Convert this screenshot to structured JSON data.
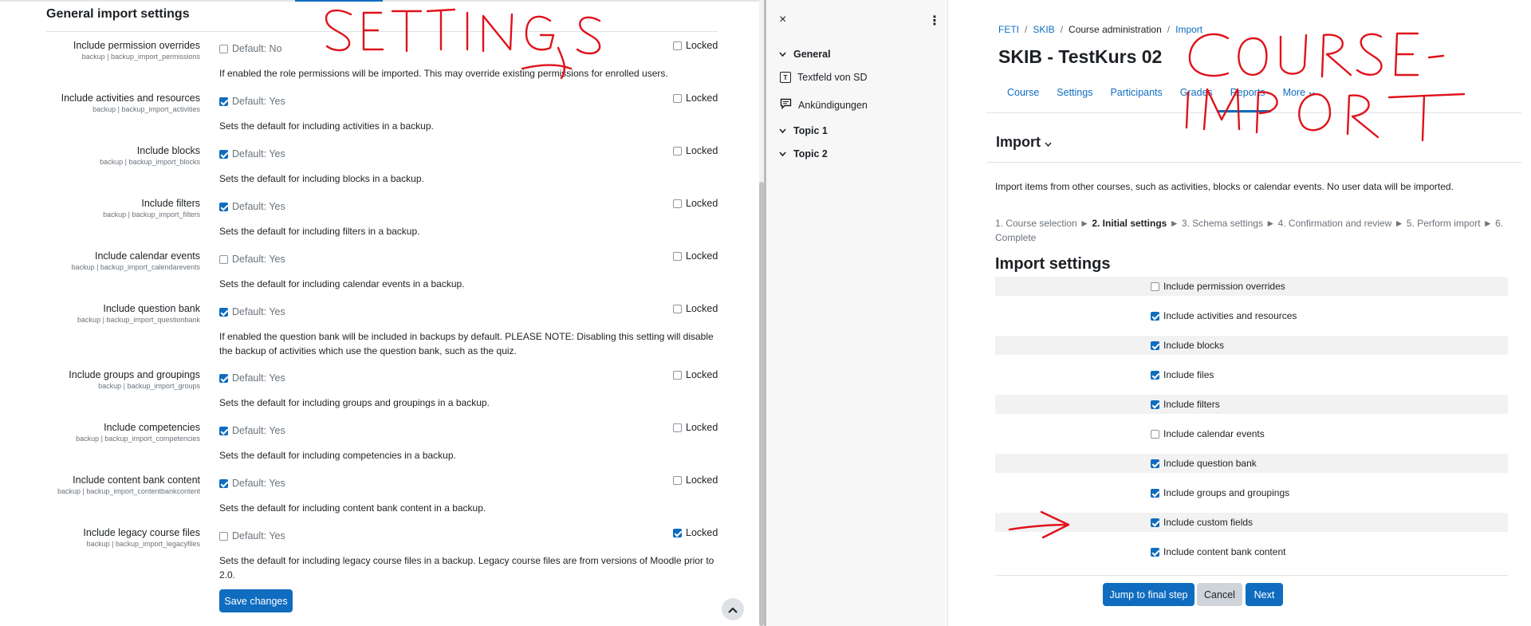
{
  "admin": {
    "section_title": "General import settings",
    "settings": [
      {
        "label": "Include permission overrides",
        "sub": "backup | backup_import_permissions",
        "default_label": "Default: No",
        "default_checked": false,
        "locked_label": "Locked",
        "locked_checked": false,
        "desc": "If enabled the role permissions will be imported. This may override existing permissions for enrolled users."
      },
      {
        "label": "Include activities and resources",
        "sub": "backup | backup_import_activities",
        "default_label": "Default: Yes",
        "default_checked": true,
        "locked_label": "Locked",
        "locked_checked": false,
        "desc": "Sets the default for including activities in a backup."
      },
      {
        "label": "Include blocks",
        "sub": "backup | backup_import_blocks",
        "default_label": "Default: Yes",
        "default_checked": true,
        "locked_label": "Locked",
        "locked_checked": false,
        "desc": "Sets the default for including blocks in a backup."
      },
      {
        "label": "Include filters",
        "sub": "backup | backup_import_filters",
        "default_label": "Default: Yes",
        "default_checked": true,
        "locked_label": "Locked",
        "locked_checked": false,
        "desc": "Sets the default for including filters in a backup."
      },
      {
        "label": "Include calendar events",
        "sub": "backup | backup_import_calendarevents",
        "default_label": "Default: Yes",
        "default_checked": false,
        "locked_label": "Locked",
        "locked_checked": false,
        "desc": "Sets the default for including calendar events in a backup."
      },
      {
        "label": "Include question bank",
        "sub": "backup | backup_import_questionbank",
        "default_label": "Default: Yes",
        "default_checked": true,
        "locked_label": "Locked",
        "locked_checked": false,
        "desc": "If enabled the question bank will be included in backups by default. PLEASE NOTE: Disabling this setting will disable the backup of activities which use the question bank, such as the quiz."
      },
      {
        "label": "Include groups and groupings",
        "sub": "backup | backup_import_groups",
        "default_label": "Default: Yes",
        "default_checked": true,
        "locked_label": "Locked",
        "locked_checked": false,
        "desc": "Sets the default for including groups and groupings in a backup."
      },
      {
        "label": "Include competencies",
        "sub": "backup | backup_import_competencies",
        "default_label": "Default: Yes",
        "default_checked": true,
        "locked_label": "Locked",
        "locked_checked": false,
        "desc": "Sets the default for including competencies in a backup."
      },
      {
        "label": "Include content bank content",
        "sub": "backup | backup_import_contentbankcontent",
        "default_label": "Default: Yes",
        "default_checked": true,
        "locked_label": "Locked",
        "locked_checked": false,
        "desc": "Sets the default for including content bank content in a backup."
      },
      {
        "label": "Include legacy course files",
        "sub": "backup | backup_import_legacyfiles",
        "default_label": "Default: Yes",
        "default_checked": false,
        "locked_label": "Locked",
        "locked_checked": true,
        "desc": "Sets the default for including legacy course files in a backup. Legacy course files are from versions of Moodle prior to 2.0."
      }
    ],
    "save_label": "Save changes",
    "scroll_up_symbol": "^"
  },
  "drawer": {
    "close_symbol": "×",
    "kebab_symbol": "⋮",
    "items": [
      {
        "label": "General",
        "kind": "section"
      },
      {
        "label": "Textfeld von SD",
        "kind": "activity",
        "icon": "text-area-icon"
      },
      {
        "label": "Ankündigungen",
        "kind": "activity",
        "icon": "forum-icon"
      },
      {
        "label": "Topic 1",
        "kind": "section"
      },
      {
        "label": "Topic 2",
        "kind": "section"
      }
    ]
  },
  "course": {
    "breadcrumbs": [
      "FETI",
      "SKIB",
      "Course administration",
      "Import"
    ],
    "title": "SKIB - TestKurs 02",
    "tabs": [
      "Course",
      "Settings",
      "Participants",
      "Grades",
      "Reports",
      "More"
    ],
    "active_tab": "More",
    "page_heading": "Import",
    "intro": "Import items from other courses, such as activities, blocks or calendar events. No user data will be imported.",
    "steps": {
      "s1": "1. Course selection",
      "arrow": "►",
      "s2": "2. Initial settings",
      "s3": "3. Schema settings",
      "s4": "4. Confirmation and review",
      "s5": "5. Perform import",
      "s6": "6. Complete"
    },
    "settings_heading": "Import settings",
    "options": [
      {
        "label": "Include permission overrides",
        "checked": false
      },
      {
        "label": "Include activities and resources",
        "checked": true
      },
      {
        "label": "Include blocks",
        "checked": true
      },
      {
        "label": "Include files",
        "checked": true
      },
      {
        "label": "Include filters",
        "checked": true
      },
      {
        "label": "Include calendar events",
        "checked": false
      },
      {
        "label": "Include question bank",
        "checked": true
      },
      {
        "label": "Include groups and groupings",
        "checked": true
      },
      {
        "label": "Include custom fields",
        "checked": true
      },
      {
        "label": "Include content bank content",
        "checked": true
      }
    ],
    "buttons": {
      "jump": "Jump to final step",
      "cancel": "Cancel",
      "next": "Next"
    }
  },
  "annotations": {
    "ink_color": "#e0121b",
    "left_word": "SETTINGS",
    "right_word_1": "COURSE -",
    "right_word_2": "IMPORT"
  }
}
